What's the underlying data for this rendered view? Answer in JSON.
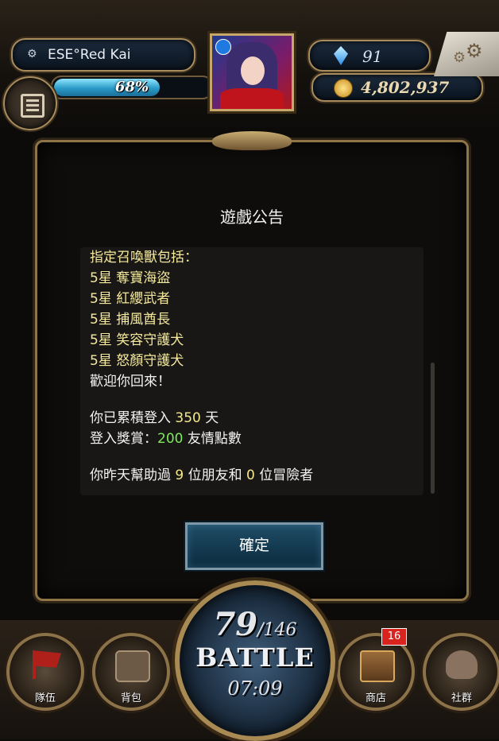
{
  "player": {
    "name": "ESE°Red Kai",
    "xp_percent_label": "68%",
    "xp_fraction": 0.68,
    "gems": "91",
    "gold": "4,802,937"
  },
  "dialog": {
    "title": "遊戲公告",
    "lines": [
      {
        "text": "指定召喚獸包括：",
        "style": "yellow"
      },
      {
        "text": "5星 奪寶海盜",
        "style": "yellow"
      },
      {
        "text": "5星 紅纓武者",
        "style": "yellow"
      },
      {
        "text": "5星 捕風酋長",
        "style": "yellow"
      },
      {
        "text": "5星 笑容守護犬",
        "style": "yellow"
      },
      {
        "text": "5星 怒顏守護犬",
        "style": "yellow"
      },
      {
        "text": "歡迎你回來！",
        "style": "white"
      }
    ],
    "login_prefix": "你已累積登入",
    "login_days": "350",
    "login_suffix": "天",
    "reward_prefix": "登入獎賞：",
    "reward_value": "200",
    "reward_suffix": "友情點數",
    "help_prefix": "你昨天幫助過",
    "help_friends": "9",
    "help_middle": "位朋友和",
    "help_adventurers": "0",
    "help_suffix": "位冒險者",
    "confirm_label": "確定"
  },
  "bottom_nav": {
    "team_label": "隊伍",
    "bag_label": "背包",
    "shop_label": "商店",
    "shop_badge": "16",
    "social_label": "社群"
  },
  "battle": {
    "stamina_current": "79",
    "stamina_max": "/146",
    "label": "BATTLE",
    "timer": "07:09"
  },
  "colors": {
    "highlight_yellow": "#f4e98a",
    "highlight_green": "#7dea5d",
    "xp_bar": "#2a9ac8",
    "badge_red": "#d8231e"
  }
}
